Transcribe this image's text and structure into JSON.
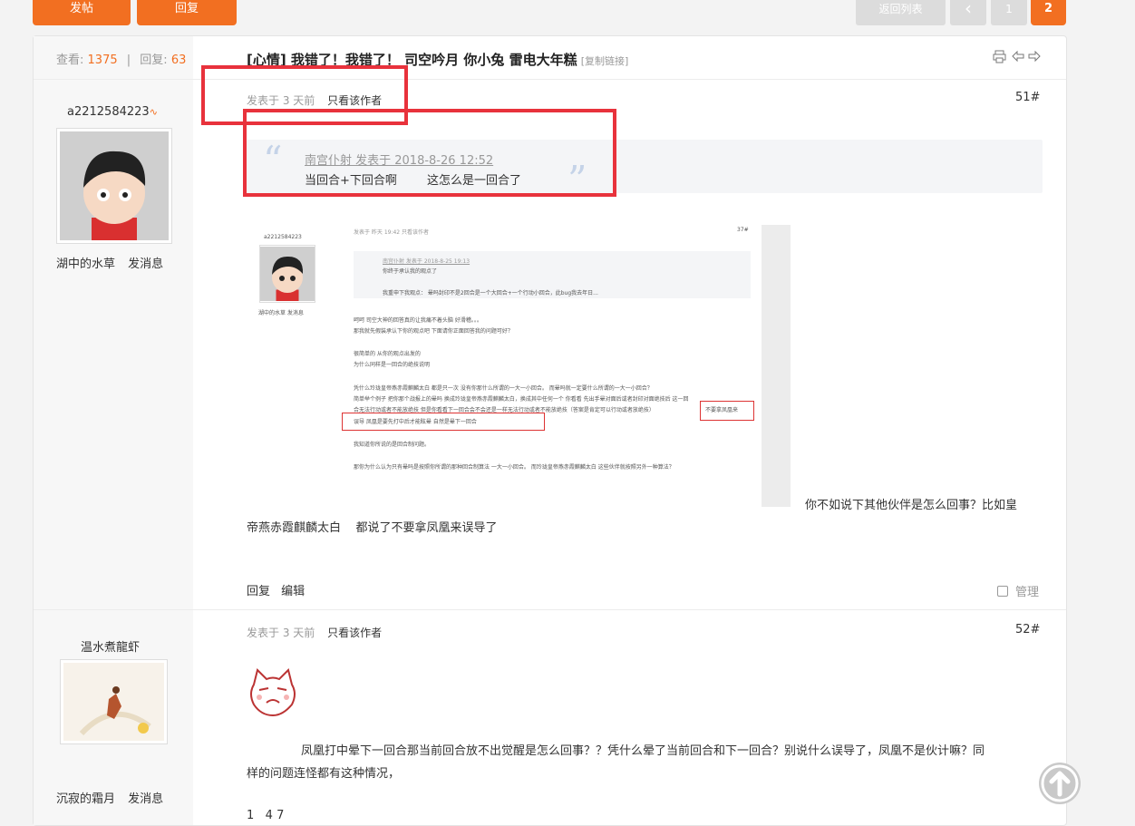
{
  "toolbar": {
    "post_label": "发帖",
    "reply_label": "回复",
    "back_label": "返回列表",
    "prev_symbol": "‹",
    "page1": "1",
    "page2": "2"
  },
  "thread": {
    "views_label": "查看:",
    "views": "1375",
    "replies_label": "回复:",
    "replies": "63",
    "title": "[心情] 我错了！我错了！ 司空吟月 你小兔 雷电大年糕",
    "copy_link": "[复制链接]"
  },
  "post1": {
    "username": "a2212584223",
    "title_label": "湖中的水草",
    "msg_label": "发消息",
    "time": "发表于 3 天前",
    "author_only": "只看该作者",
    "floor": "51#",
    "quote_head": "南宫仆射 发表于 2018-8-26 12:52",
    "quote_body": "当回合+下回合啊        这怎么是一回合了",
    "body_tail1": "你不如说下其他伙伴是怎么回事？比如皇",
    "body_tail2": "帝燕赤霞麒麟太白    都说了不要拿凤凰来误导了",
    "reply": "回复",
    "edit": "编辑",
    "manage": "管理",
    "shot": {
      "username": "a2212584223",
      "user_line": "湖中的水草   发消息",
      "meta": "发表于 昨天 19:42    只看该作者",
      "floor": "37#",
      "quote_head": "南宫仆射 发表于 2018-8-25 19:13",
      "quote_l1": "你终于承认我的观点了",
      "quote_l2": "我重申下我观点： 晕吗封印不是2回合是一个大回合+一个行动小回合，此bug我去年日...",
      "l1": "呵呵 司空大神的回答真的让我痛不着头脑 好滑稽。。。",
      "l2": "那我就先假装承认下你的观点吧  下面请你正面回答我的问题可好？",
      "l3": "很简单的  从你的观点出发的",
      "l4": "为什么同样是一回合的绝技说明",
      "l5": "凭什么玲珑皇帝燕赤霞麒麟太白  都是只一次  没有你那什么所谓的一大一小回合。    而晕吗就一定要什么所谓的一大一小回合？",
      "l6": "简单举个例子 把你那个战报上的晕吗 换成玲珑皇帝燕赤霞麒麟太白，换成其中任何一个 你看看  先出手晕对面后或者封印对面绝技后 这一回",
      "l7": "合无法行动或者不能放绝技  但是你看看下一回合会不会还是一样无法行动或者不能放绝技（答案是肯定可以行动或者放绝技）",
      "l7b": "不要拿凤凰来",
      "l8": "误导 凤凰是要先打中后才能眩晕 自然是晕下一回合",
      "l9": "我知道你所说的是回合制问题。",
      "l10": "那你为什么认为只有晕吗是按照你所谓的那种回合制算法  一大一小回合。  而玲珑皇帝燕赤霞麒麟太白 这些伙伴就按照另外一种算法？"
    }
  },
  "post2": {
    "username": "温水煮龍虾",
    "title_label": "沉寂的霜月",
    "msg_label": "发消息",
    "time": "发表于 3 天前",
    "author_only": "只看该作者",
    "floor": "52#",
    "body1": "凤凰打中晕下一回合那当前回合放不出觉醒是怎么回事？？凭什么晕了当前回合和下一回合？别说什么误导了，凤凰不是伙计嘛？同",
    "body2": "样的问题连怪都有这种情况，",
    "body3": "1   4 7"
  },
  "icons": [
    "print-icon",
    "prev-thread-icon",
    "next-thread-icon",
    "scroll-top-icon",
    "quote-open-icon",
    "quote-close-icon"
  ],
  "colors": {
    "accent": "#f26f21",
    "highlight_box": "#e8323c"
  }
}
